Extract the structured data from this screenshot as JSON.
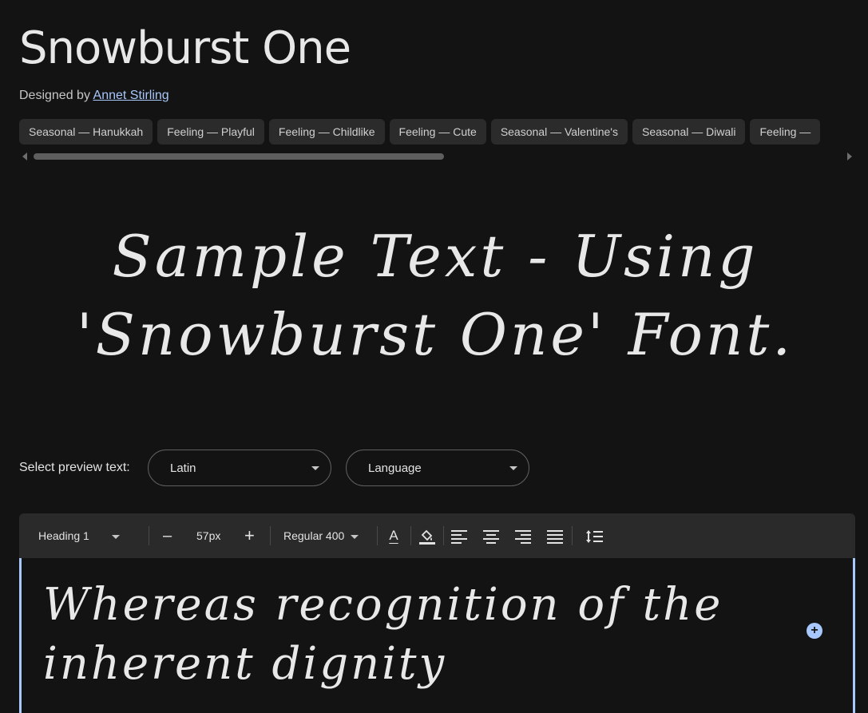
{
  "font": {
    "name": "Snowburst One",
    "designed_by_label": "Designed by",
    "designer": "Annet Stirling"
  },
  "tags": [
    "Seasonal — Hanukkah",
    "Feeling — Playful",
    "Feeling — Childlike",
    "Feeling — Cute",
    "Seasonal — Valentine's",
    "Seasonal — Diwali",
    "Feeling —"
  ],
  "hero_text": "Sample Text - Using 'Snowburst One' Font.",
  "preview": {
    "label": "Select preview text:",
    "script_select": "Latin",
    "language_select": "Language"
  },
  "toolbar": {
    "style_select": "Heading 1",
    "minus_label": "–",
    "size_value": "57px",
    "plus_label": "+",
    "weight_select": "Regular 400",
    "text_color_label": "A"
  },
  "editor_text": "Whereas recognition of the inherent dignity",
  "colors": {
    "background": "#131313",
    "chip": "#2b2b2b",
    "accent": "#a8c7fa"
  }
}
